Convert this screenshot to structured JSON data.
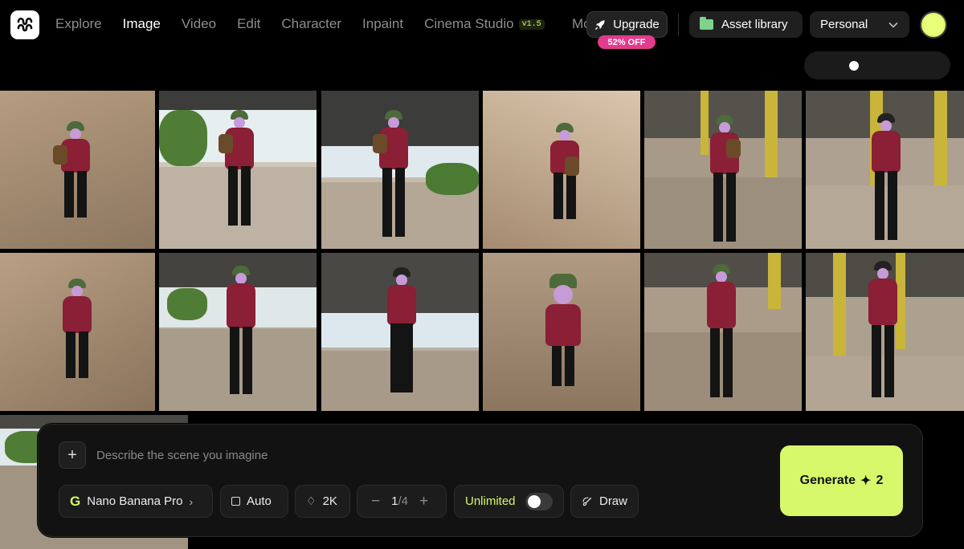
{
  "nav": {
    "items": [
      "Explore",
      "Image",
      "Video",
      "Edit",
      "Character",
      "Inpaint",
      "Cinema Studio"
    ],
    "active": "Image",
    "cinema_badge": "v1.5",
    "clipped_item": "Mo"
  },
  "upgrade": {
    "label": "Upgrade",
    "promo": "52% OFF"
  },
  "asset_library": {
    "label": "Asset library"
  },
  "workspace": {
    "selected": "Personal"
  },
  "zoom": {
    "level": 0.3
  },
  "prompt": {
    "placeholder": "Describe the scene you imagine",
    "value": ""
  },
  "controls": {
    "model": "Nano Banana Pro",
    "model_icon": "G",
    "aspect": "Auto",
    "resolution": "2K",
    "batch_current": "1",
    "batch_total": "/4",
    "unlimited_label": "Unlimited",
    "unlimited_on": false,
    "draw_label": "Draw"
  },
  "generate": {
    "label": "Generate",
    "cost": "2"
  },
  "colors": {
    "accent": "#d7f86a",
    "promo": "#e23b8b",
    "hoodie": "#8a1f35",
    "hat": "#4d6a3a"
  },
  "gallery": {
    "image_count": 13
  }
}
